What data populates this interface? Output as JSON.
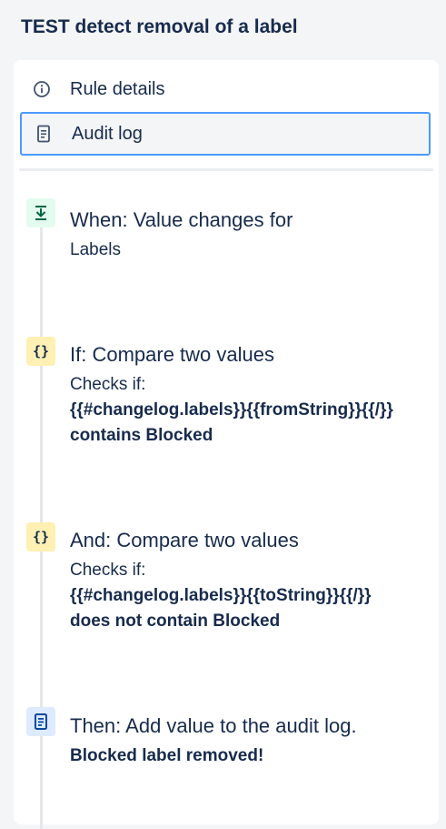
{
  "header": {
    "title": "TEST detect removal of a label"
  },
  "nav": {
    "items": [
      {
        "label": "Rule details",
        "icon": "info-icon",
        "selected": false
      },
      {
        "label": "Audit log",
        "icon": "document-icon",
        "selected": true
      }
    ]
  },
  "steps": [
    {
      "type": "trigger",
      "icon": "download-icon",
      "title": "When: Value changes for",
      "lines": [
        "Labels"
      ]
    },
    {
      "type": "condition",
      "icon": "braces-icon",
      "title": "If: Compare two values",
      "lines": [
        "Checks if:"
      ],
      "bold": [
        "{{#changelog.labels}}{{fromString}}{{/}}",
        "contains Blocked"
      ]
    },
    {
      "type": "condition",
      "icon": "braces-icon",
      "title": "And: Compare two values",
      "lines": [
        "Checks if:"
      ],
      "bold": [
        "{{#changelog.labels}}{{toString}}{{/}}",
        "does not contain Blocked"
      ]
    },
    {
      "type": "action",
      "icon": "document-icon",
      "title": "Then: Add value to the audit log.",
      "bold": [
        "Blocked label removed!"
      ]
    }
  ],
  "colors": {
    "selected_border": "#4c9aff",
    "trigger_bg": "#e3fcef",
    "condition_bg": "#fff0b3",
    "action_bg": "#deebff"
  }
}
